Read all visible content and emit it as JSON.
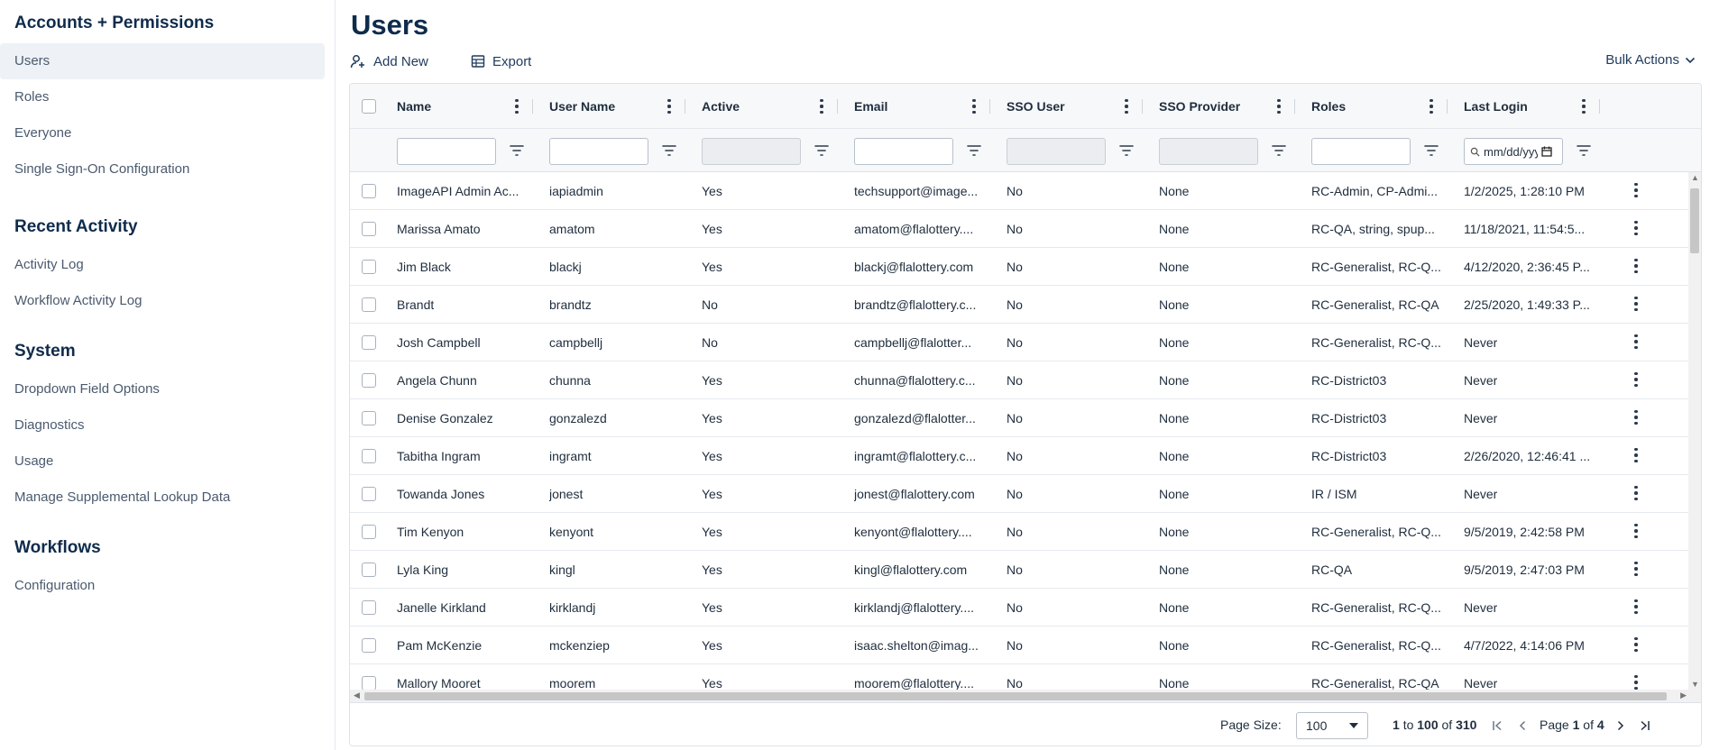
{
  "sidebar": {
    "sections": [
      {
        "title": "Accounts + Permissions",
        "items": [
          "Users",
          "Roles",
          "Everyone",
          "Single Sign-On Configuration"
        ]
      },
      {
        "title": "Recent Activity",
        "items": [
          "Activity Log",
          "Workflow Activity Log"
        ]
      },
      {
        "title": "System",
        "items": [
          "Dropdown Field Options",
          "Diagnostics",
          "Usage",
          "Manage Supplemental Lookup Data"
        ]
      },
      {
        "title": "Workflows",
        "items": [
          "Configuration"
        ]
      }
    ],
    "active_item": "Users"
  },
  "page": {
    "title": "Users",
    "add_new_label": "Add New",
    "export_label": "Export",
    "bulk_actions_label": "Bulk Actions"
  },
  "grid": {
    "columns": [
      "Name",
      "User Name",
      "Active",
      "Email",
      "SSO User",
      "SSO Provider",
      "Roles",
      "Last Login"
    ],
    "date_placeholder": "mm/dd/yyyy",
    "rows": [
      [
        "ImageAPI Admin Ac...",
        "iapiadmin",
        "Yes",
        "techsupport@image...",
        "No",
        "None",
        "RC-Admin, CP-Admi...",
        "1/2/2025, 1:28:10 PM"
      ],
      [
        "Marissa Amato",
        "amatom",
        "Yes",
        "amatom@flalottery....",
        "No",
        "None",
        "RC-QA, string, spup...",
        "11/18/2021, 11:54:5..."
      ],
      [
        "Jim Black",
        "blackj",
        "Yes",
        "blackj@flalottery.com",
        "No",
        "None",
        "RC-Generalist, RC-Q...",
        "4/12/2020, 2:36:45 P..."
      ],
      [
        "Brandt",
        "brandtz",
        "No",
        "brandtz@flalottery.c...",
        "No",
        "None",
        "RC-Generalist, RC-QA",
        "2/25/2020, 1:49:33 P..."
      ],
      [
        "Josh Campbell",
        "campbellj",
        "No",
        "campbellj@flalotter...",
        "No",
        "None",
        "RC-Generalist, RC-Q...",
        "Never"
      ],
      [
        "Angela Chunn",
        "chunna",
        "Yes",
        "chunna@flalottery.c...",
        "No",
        "None",
        "RC-District03",
        "Never"
      ],
      [
        "Denise Gonzalez",
        "gonzalezd",
        "Yes",
        "gonzalezd@flalotter...",
        "No",
        "None",
        "RC-District03",
        "Never"
      ],
      [
        "Tabitha Ingram",
        "ingramt",
        "Yes",
        "ingramt@flalottery.c...",
        "No",
        "None",
        "RC-District03",
        "2/26/2020, 12:46:41 ..."
      ],
      [
        "Towanda Jones",
        "jonest",
        "Yes",
        "jonest@flalottery.com",
        "No",
        "None",
        "IR / ISM",
        "Never"
      ],
      [
        "Tim Kenyon",
        "kenyont",
        "Yes",
        "kenyont@flalottery....",
        "No",
        "None",
        "RC-Generalist, RC-Q...",
        "9/5/2019, 2:42:58 PM"
      ],
      [
        "Lyla King",
        "kingl",
        "Yes",
        "kingl@flalottery.com",
        "No",
        "None",
        "RC-QA",
        "9/5/2019, 2:47:03 PM"
      ],
      [
        "Janelle Kirkland",
        "kirklandj",
        "Yes",
        "kirklandj@flalottery....",
        "No",
        "None",
        "RC-Generalist, RC-Q...",
        "Never"
      ],
      [
        "Pam McKenzie",
        "mckenziep",
        "Yes",
        "isaac.shelton@imag...",
        "No",
        "None",
        "RC-Generalist, RC-Q...",
        "4/7/2022, 4:14:06 PM"
      ],
      [
        "Mallory Mooret",
        "moorem",
        "Yes",
        "moorem@flalottery....",
        "No",
        "None",
        "RC-Generalist, RC-QA",
        "Never"
      ]
    ]
  },
  "pagination": {
    "page_size_label": "Page Size:",
    "page_size": "100",
    "range_from": "1",
    "range_to_word": "to",
    "range_to": "100",
    "of_word": "of",
    "total": "310",
    "page_word": "Page",
    "page_current": "1",
    "page_total": "4"
  },
  "colors": {
    "heading": "#0f2b4c",
    "text": "#1f2d3d",
    "muted": "#4a5a6e",
    "border": "#dde2e8",
    "header_bg": "#f7f8fa"
  }
}
